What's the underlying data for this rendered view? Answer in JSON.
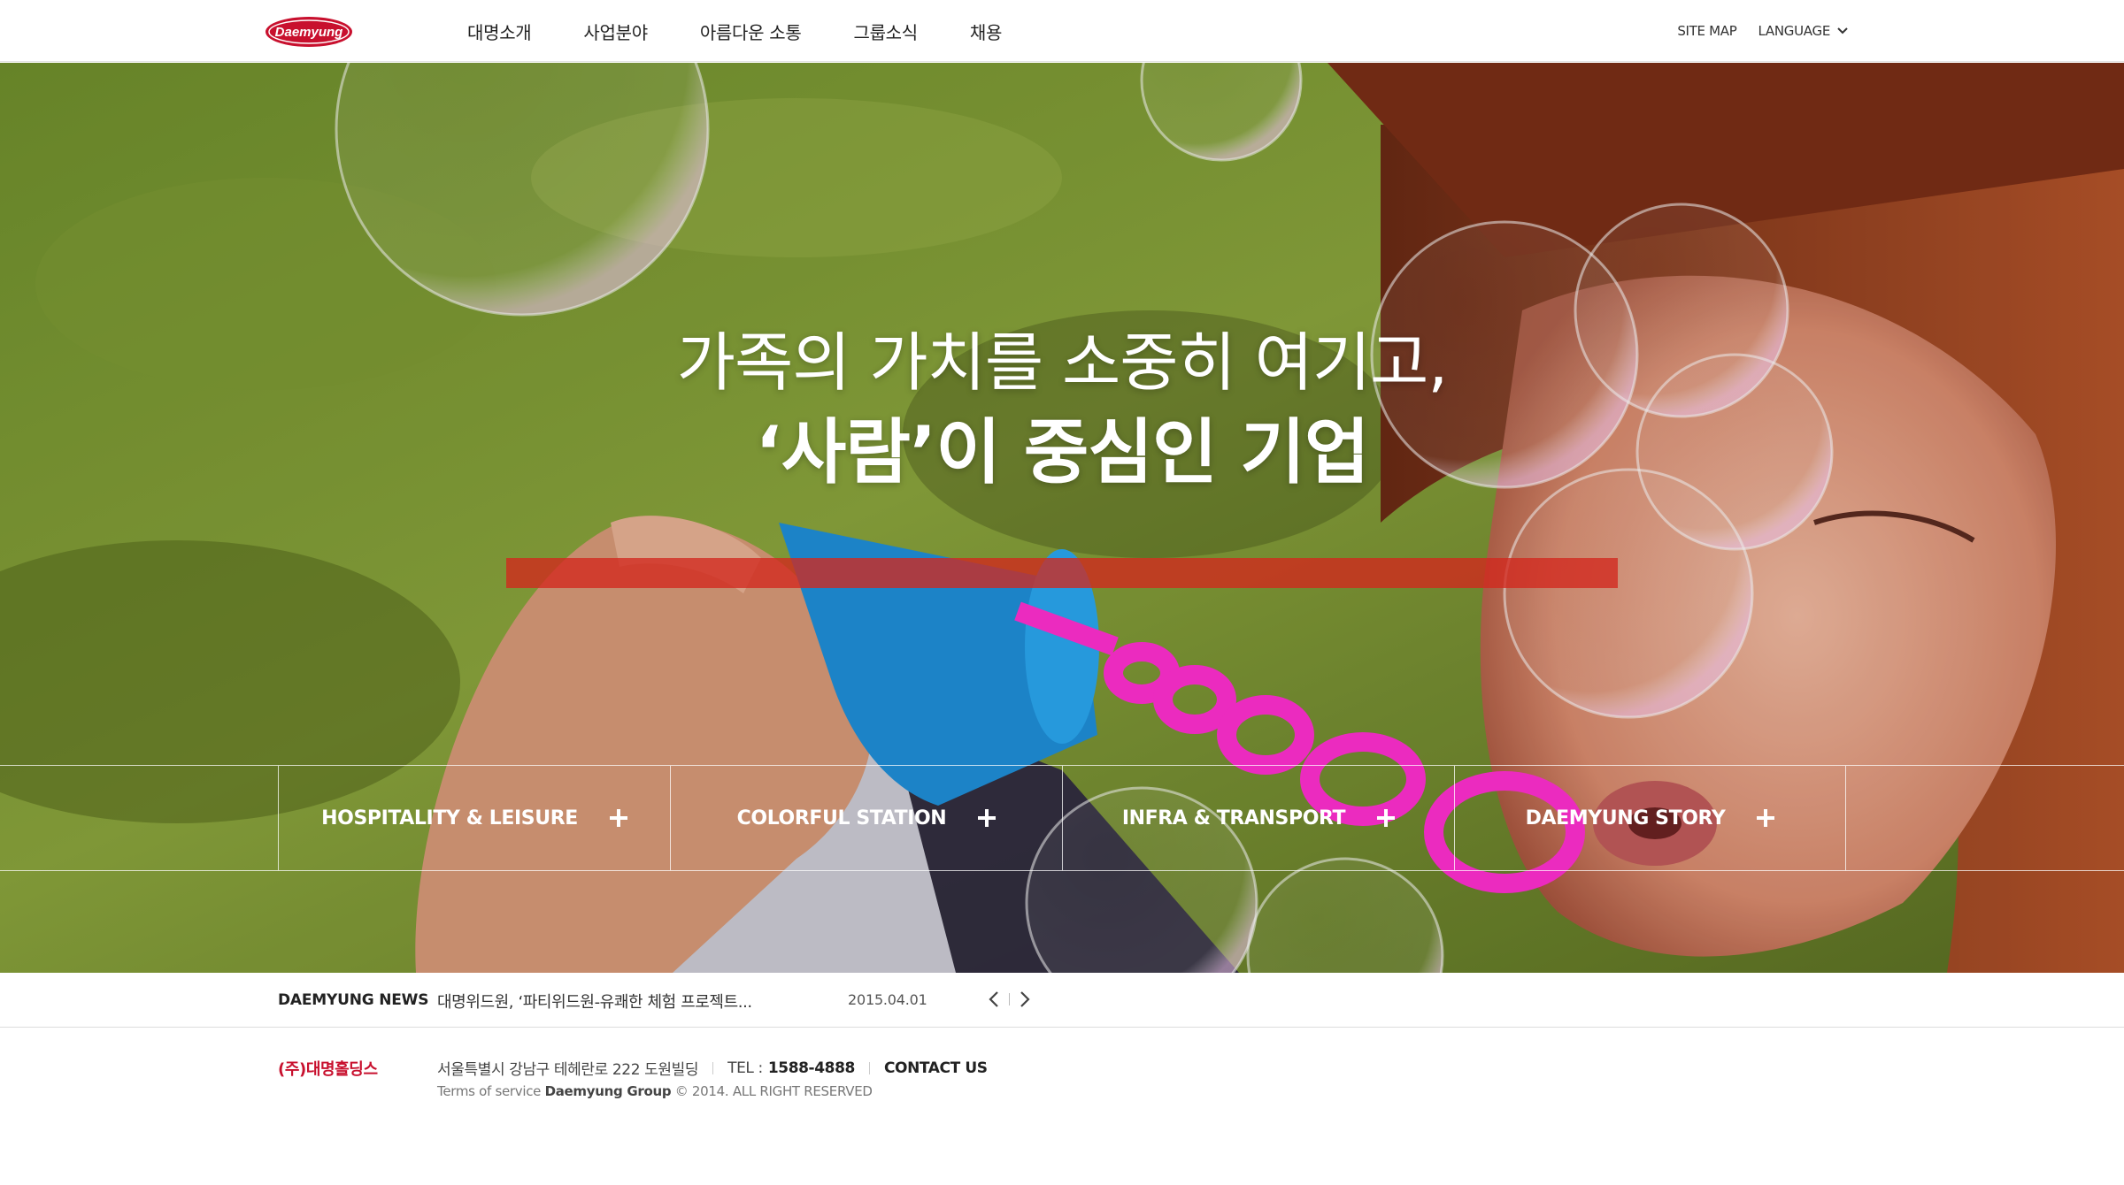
{
  "header": {
    "logo_text": "Daemyung",
    "nav": [
      "대명소개",
      "사업분야",
      "아름다운 소통",
      "그룹소식",
      "채용"
    ],
    "site_map": "SITE MAP",
    "language": "LANGUAGE"
  },
  "hero": {
    "headline_line1": "가족의 가치를 소중히 여기고,",
    "headline_line2": "‘사람’이 중심인 기업"
  },
  "categories": [
    {
      "label": "HOSPITALITY & LEISURE",
      "icon": "plus-icon"
    },
    {
      "label": "COLORFUL STATION",
      "icon": "plus-icon"
    },
    {
      "label": "INFRA & TRANSPORT",
      "icon": "plus-icon"
    },
    {
      "label": "DAEMYUNG STORY",
      "icon": "plus-icon"
    }
  ],
  "news": {
    "label": "DAEMYUNG NEWS",
    "title": "대명위드원, ‘파티위드원-유쾌한 체험 프로젝트...",
    "date": "2015.04.01",
    "prev_icon": "chevron-left-icon",
    "next_icon": "chevron-right-icon"
  },
  "footer": {
    "company": "(주)대명홀딩스",
    "address": "서울특별시 강남구 테헤란로 222 도원빌딩",
    "tel_label": "TEL :",
    "tel": "1588-4888",
    "contact": "CONTACT US",
    "terms": "Terms of service",
    "group": "Daemyung Group",
    "copyright": "© 2014. ALL RIGHT RESERVED"
  },
  "colors": {
    "brand_red": "#c8102e",
    "hero_band": "#d2281e",
    "bubble_wand": "#ff2fd0"
  }
}
